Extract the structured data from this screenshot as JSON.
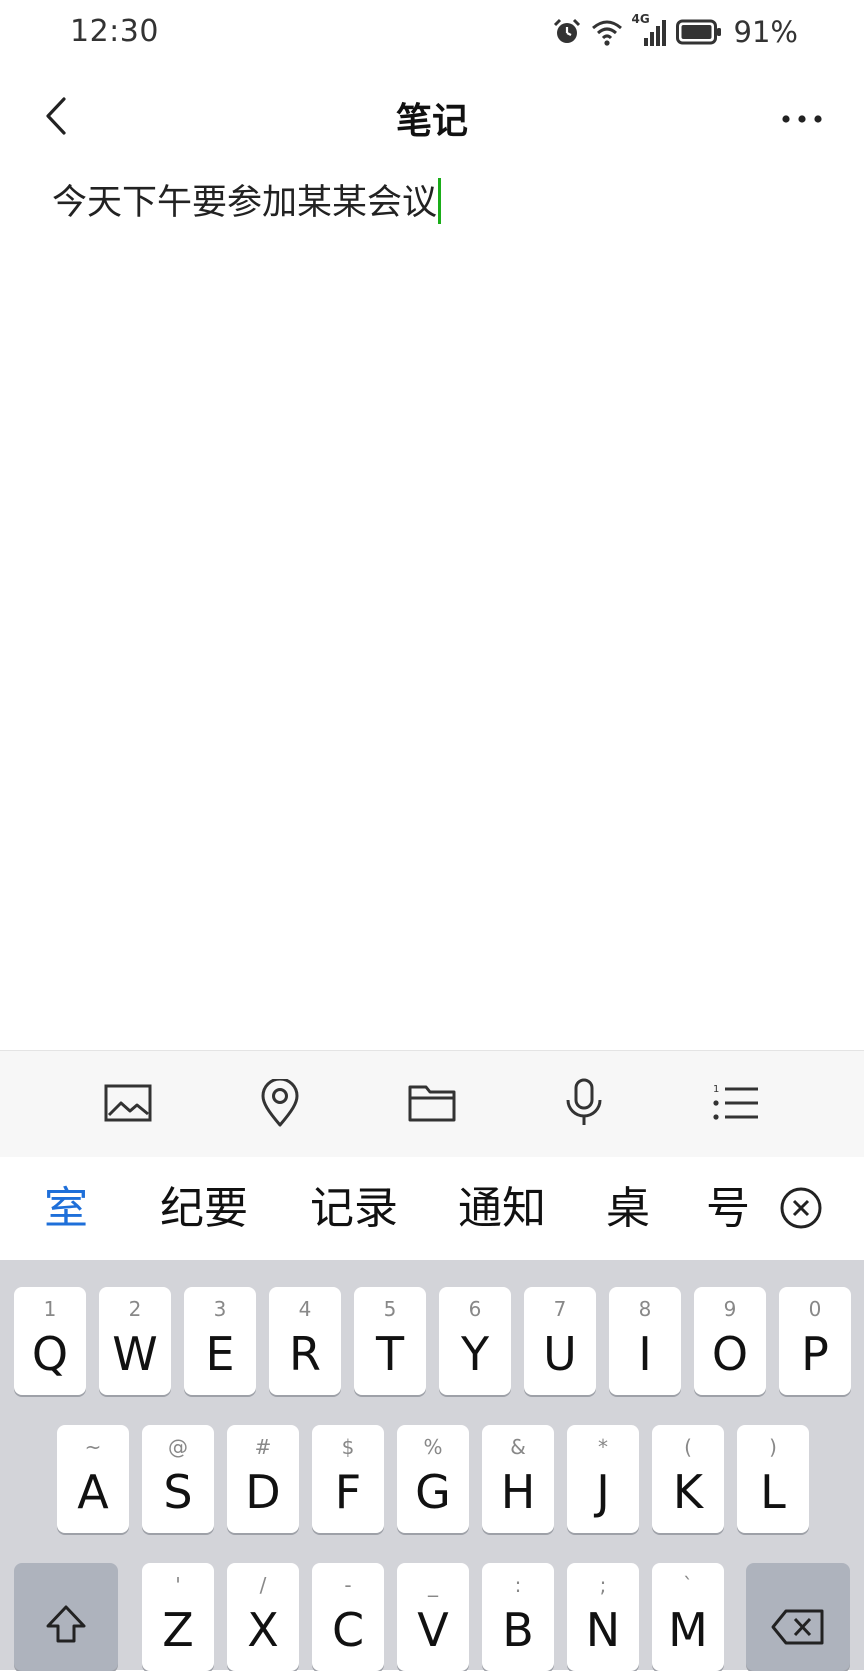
{
  "status_bar": {
    "time": "12:30",
    "network": "4G",
    "battery": "91%",
    "icons": [
      "alarm-icon",
      "wifi-icon",
      "signal-icon",
      "battery-icon"
    ]
  },
  "header": {
    "title": "笔记",
    "back_icon": "chevron-left-icon",
    "more_icon": "more-dots-icon"
  },
  "note": {
    "text": "今天下午要参加某某会议"
  },
  "toolbar": {
    "tools": [
      "image-icon",
      "location-pin-icon",
      "folder-icon",
      "microphone-icon",
      "numbered-list-icon"
    ]
  },
  "candidates": {
    "items": [
      "室",
      "纪要",
      "记录",
      "通知",
      "桌",
      "号"
    ],
    "active_index": 0,
    "active_color": "#1e6fd9",
    "close_icon": "close-circle-icon"
  },
  "keyboard": {
    "row1": [
      {
        "hint": "1",
        "letter": "Q"
      },
      {
        "hint": "2",
        "letter": "W"
      },
      {
        "hint": "3",
        "letter": "E"
      },
      {
        "hint": "4",
        "letter": "R"
      },
      {
        "hint": "5",
        "letter": "T"
      },
      {
        "hint": "6",
        "letter": "Y"
      },
      {
        "hint": "7",
        "letter": "U"
      },
      {
        "hint": "8",
        "letter": "I"
      },
      {
        "hint": "9",
        "letter": "O"
      },
      {
        "hint": "0",
        "letter": "P"
      }
    ],
    "row2": [
      {
        "hint": "~",
        "letter": "A"
      },
      {
        "hint": "@",
        "letter": "S"
      },
      {
        "hint": "#",
        "letter": "D"
      },
      {
        "hint": "$",
        "letter": "F"
      },
      {
        "hint": "%",
        "letter": "G"
      },
      {
        "hint": "&",
        "letter": "H"
      },
      {
        "hint": "*",
        "letter": "J"
      },
      {
        "hint": "(",
        "letter": "K"
      },
      {
        "hint": ")",
        "letter": "L"
      }
    ],
    "row3": [
      {
        "hint": "'",
        "letter": "Z"
      },
      {
        "hint": "/",
        "letter": "X"
      },
      {
        "hint": "-",
        "letter": "C"
      },
      {
        "hint": "_",
        "letter": "V"
      },
      {
        "hint": ":",
        "letter": "B"
      },
      {
        "hint": ";",
        "letter": "N"
      },
      {
        "hint": "`",
        "letter": "M"
      }
    ],
    "shift_icon": "shift-arrow-icon",
    "backspace_icon": "backspace-icon"
  }
}
